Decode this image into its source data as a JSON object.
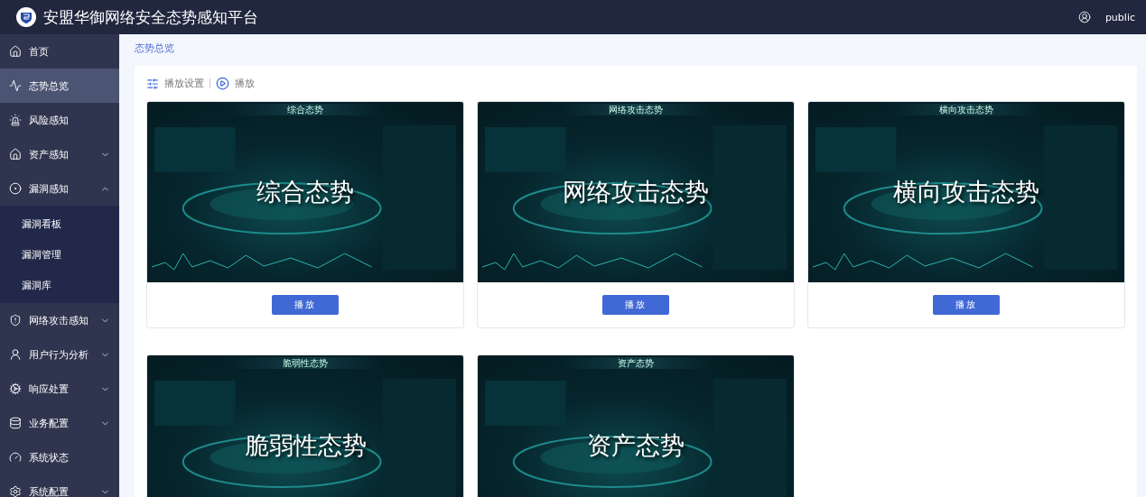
{
  "header": {
    "title": "安盟华御网络安全态势感知平台",
    "user": "public"
  },
  "sidebar": {
    "items": [
      {
        "label": "首页",
        "selected": false
      },
      {
        "label": "态势总览",
        "selected": true
      },
      {
        "label": "风险感知",
        "selected": false
      },
      {
        "label": "资产感知",
        "selected": false,
        "expanded": false
      },
      {
        "label": "漏洞感知",
        "selected": false,
        "expanded": true,
        "children": [
          {
            "label": "漏洞看板",
            "selected": false
          },
          {
            "label": "漏洞管理",
            "selected": false
          },
          {
            "label": "漏洞库",
            "selected": false
          }
        ]
      },
      {
        "label": "网络攻击感知",
        "selected": false,
        "expanded": false
      },
      {
        "label": "用户行为分析",
        "selected": false,
        "expanded": false
      },
      {
        "label": "响应处置",
        "selected": false,
        "expanded": false
      },
      {
        "label": "业务配置",
        "selected": false,
        "expanded": false
      },
      {
        "label": "系统状态",
        "selected": false
      },
      {
        "label": "系统配置",
        "selected": false,
        "expanded": false
      }
    ]
  },
  "breadcrumb": "态势总览",
  "toolbar": {
    "settings": "播放设置",
    "play": "播放"
  },
  "cards": [
    {
      "header": "综合态势",
      "title": "综合态势",
      "button": "播放"
    },
    {
      "header": "网络攻击态势",
      "title": "网络攻击态势",
      "button": "播放"
    },
    {
      "header": "横向攻击态势",
      "title": "横向攻击态势",
      "button": "播放"
    },
    {
      "header": "脆弱性态势",
      "title": "脆弱性态势"
    },
    {
      "header": "资产态势",
      "title": "资产态势"
    }
  ]
}
